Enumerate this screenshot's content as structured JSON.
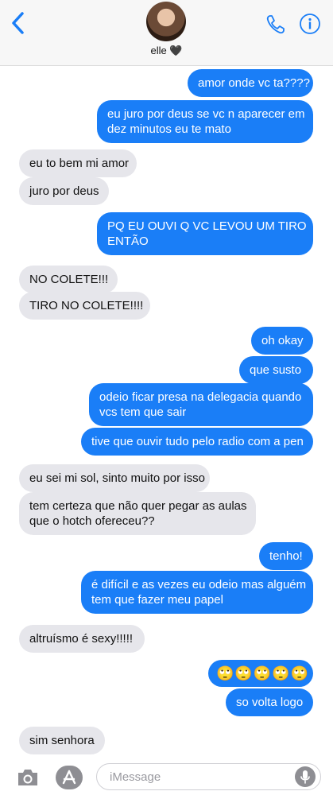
{
  "header": {
    "contact_name": "elle 🖤"
  },
  "messages": [
    {
      "dir": "out",
      "lines": [
        "amor onde vc ta????"
      ]
    },
    {
      "dir": "out",
      "lines": [
        "eu juro por deus se vc n aparecer em",
        "dez minutos eu te mato"
      ]
    },
    {
      "dir": "in",
      "lines": [
        "eu to bem mi amor"
      ]
    },
    {
      "dir": "in",
      "lines": [
        "juro por deus"
      ]
    },
    {
      "dir": "out",
      "lines": [
        "PQ EU OUVI Q VC LEVOU UM TIRO",
        "ENTÃO"
      ]
    },
    {
      "dir": "in",
      "lines": [
        "NO COLETE!!!"
      ]
    },
    {
      "dir": "in",
      "lines": [
        "TIRO NO COLETE!!!!"
      ]
    },
    {
      "dir": "out",
      "lines": [
        "oh okay"
      ]
    },
    {
      "dir": "out",
      "lines": [
        "que susto"
      ]
    },
    {
      "dir": "out",
      "lines": [
        "odeio ficar presa na delegacia quando",
        "vcs tem que sair"
      ]
    },
    {
      "dir": "out",
      "lines": [
        "tive que ouvir tudo pelo radio com a pen"
      ]
    },
    {
      "dir": "in",
      "lines": [
        "eu sei mi sol, sinto muito por isso"
      ]
    },
    {
      "dir": "in",
      "lines": [
        "tem certeza que não quer pegar as aulas",
        "que o hotch ofereceu??"
      ]
    },
    {
      "dir": "out",
      "lines": [
        "tenho!"
      ]
    },
    {
      "dir": "out",
      "lines": [
        "é difícil e as vezes eu odeio mas alguém",
        "tem que fazer meu papel"
      ]
    },
    {
      "dir": "in",
      "lines": [
        "altruísmo é sexy!!!!!"
      ]
    },
    {
      "dir": "out",
      "lines": [
        "🙄🙄🙄🙄🙄"
      ],
      "emoji": true
    },
    {
      "dir": "out",
      "lines": [
        "so volta logo"
      ]
    },
    {
      "dir": "in",
      "lines": [
        "sim senhora"
      ]
    }
  ],
  "composer": {
    "placeholder": "iMessage"
  },
  "colors": {
    "outgoing_bubble": "#1a7ef7",
    "incoming_bubble": "#e6e6eb",
    "accent": "#1a7ef7"
  },
  "icons": [
    "back-chevron-icon",
    "phone-icon",
    "info-icon",
    "camera-icon",
    "app-store-icon",
    "microphone-icon"
  ]
}
